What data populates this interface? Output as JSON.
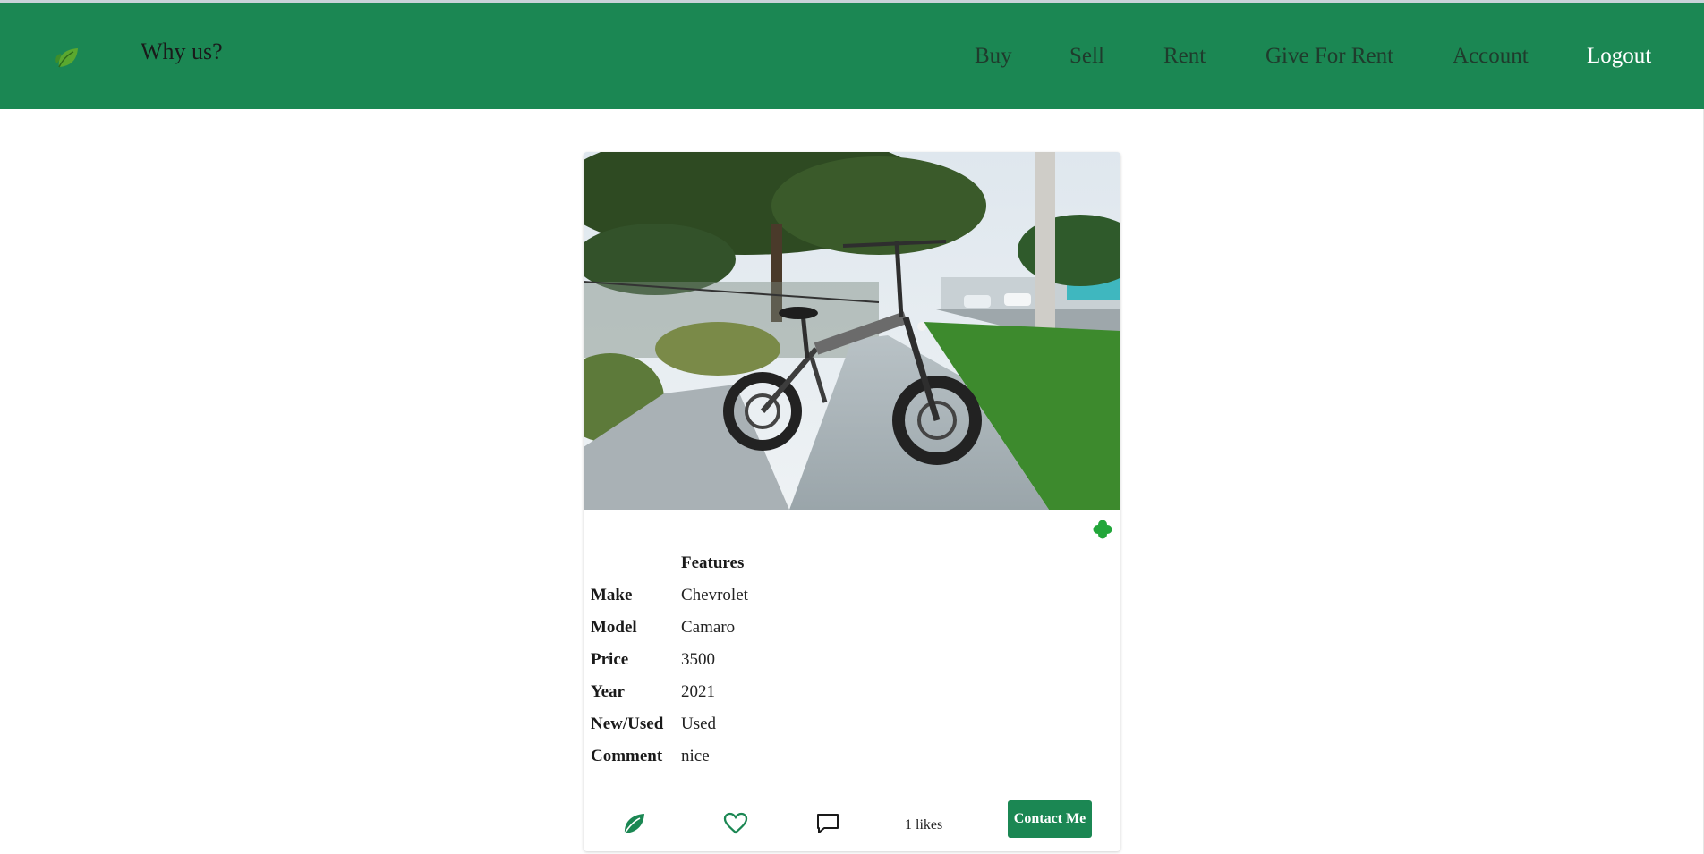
{
  "nav": {
    "why_label": "Why us?",
    "links": [
      {
        "label": "Buy"
      },
      {
        "label": "Sell"
      },
      {
        "label": "Rent"
      },
      {
        "label": "Give For Rent"
      },
      {
        "label": "Account"
      },
      {
        "label": "Logout"
      }
    ]
  },
  "listing": {
    "image_alt": "Electric fat-tire folding bike on sidewalk",
    "features_header": "Features",
    "rows": [
      {
        "label": "Make",
        "value": "Chevrolet"
      },
      {
        "label": "Model",
        "value": "Camaro"
      },
      {
        "label": "Price",
        "value": "3500"
      },
      {
        "label": "Year",
        "value": "2021"
      },
      {
        "label": "New/Used",
        "value": "Used"
      },
      {
        "label": "Comment",
        "value": "nice"
      }
    ],
    "likes_text": "1 likes",
    "contact_label": "Contact Me"
  },
  "icons": {
    "logo": "leaf-icon",
    "clover": "clover-icon",
    "leaf_action": "leaf-icon",
    "like": "heart-icon",
    "comment": "comment-icon"
  },
  "colors": {
    "brand_green": "#1b8753",
    "nav_text": "#1f3b2c",
    "active_nav": "#ffffff",
    "clover": "#22a63a"
  }
}
